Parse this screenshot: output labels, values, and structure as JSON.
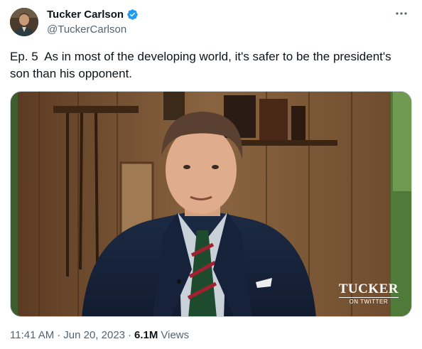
{
  "author": {
    "display_name": "Tucker Carlson",
    "handle": "@TuckerCarlson",
    "avatar_icon": "profile-photo",
    "verified_icon": "verified-badge-icon",
    "verified_color": "#1d9bf0"
  },
  "more_icon": "more-dots-icon",
  "tweet": {
    "text": "Ep. 5  As in most of the developing world, it's safer to be the president's son than his opponent."
  },
  "media": {
    "type": "video-thumbnail",
    "watermark_title": "TUCKER",
    "watermark_subtitle": "ON TWITTER"
  },
  "meta": {
    "time": "11:41 AM",
    "separator": "·",
    "date": "Jun 20, 2023",
    "views_count": "6.1M",
    "views_label": "Views"
  },
  "colors": {
    "text_primary": "#0f1419",
    "text_secondary": "#536471"
  }
}
